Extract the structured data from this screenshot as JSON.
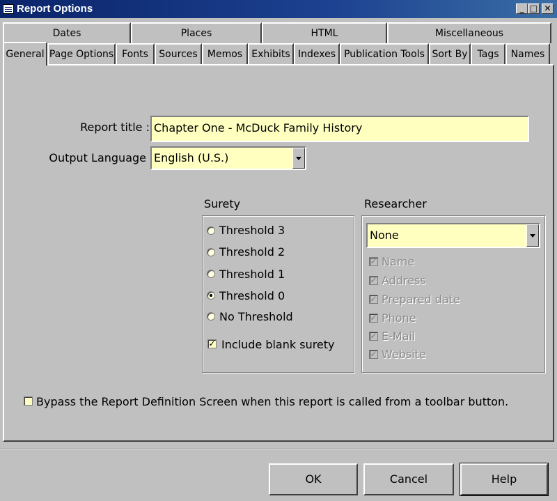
{
  "window": {
    "title": "Report Options",
    "controls": {
      "minimize": "_",
      "maximize": "□",
      "close": "✕"
    }
  },
  "tabs": {
    "back_row": [
      "Dates",
      "Places",
      "HTML",
      "Miscellaneous"
    ],
    "front_row": [
      "General",
      "Page Options",
      "Fonts",
      "Sources",
      "Memos",
      "Exhibits",
      "Indexes",
      "Publication Tools",
      "Sort By",
      "Tags",
      "Names"
    ],
    "selected": "General"
  },
  "general": {
    "report_title_label": "Report title :",
    "report_title_value": "Chapter One - McDuck Family History",
    "output_language_label": "Output Language",
    "output_language_value": "English (U.S.)"
  },
  "surety": {
    "label": "Surety",
    "options": [
      "Threshold 3",
      "Threshold 2",
      "Threshold 1",
      "Threshold 0",
      "No Threshold"
    ],
    "selected": "Threshold 0",
    "include_blank_label": "Include blank surety",
    "include_blank_checked": true
  },
  "researcher": {
    "label": "Researcher",
    "selected": "None",
    "fields": [
      "Name",
      "Address",
      "Prepared date",
      "Phone",
      "E-Mail",
      "Website"
    ],
    "fields_checked": true,
    "fields_enabled": false
  },
  "bypass": {
    "label": "Bypass the Report Definition Screen when this report is called from a toolbar button.",
    "checked": false
  },
  "buttons": {
    "ok": "OK",
    "cancel": "Cancel",
    "help": "Help"
  },
  "colors": {
    "titlebar": "#0a246a",
    "field_background": "#ffffc0",
    "dialog_face": "#c0c0c0"
  }
}
